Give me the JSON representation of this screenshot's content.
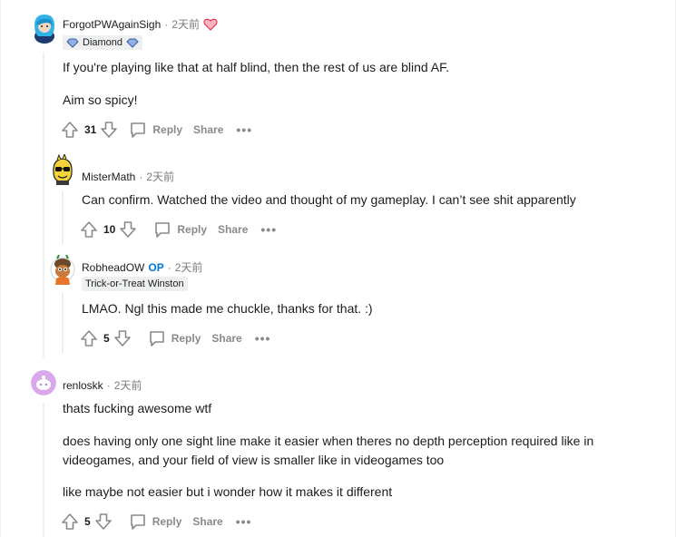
{
  "comments": [
    {
      "username": "ForgotPWAgainSigh",
      "time": "2天前",
      "flair": "Diamond",
      "paragraphs": [
        "If you're playing like that at half blind, then the rest of us are blind AF.",
        "Aim so spicy!"
      ],
      "votes": "31",
      "reply_label": "Reply",
      "share_label": "Share",
      "more_label": "•••"
    },
    {
      "username": "MisterMath",
      "time": "2天前",
      "paragraphs": [
        "Can confirm. Watched the video and thought of my gameplay. I can’t see shit apparently"
      ],
      "votes": "10",
      "reply_label": "Reply",
      "share_label": "Share",
      "more_label": "•••"
    },
    {
      "username": "RobheadOW",
      "op_badge": "OP",
      "time": "2天前",
      "flair": "Trick-or-Treat Winston",
      "paragraphs": [
        "LMAO. Ngl this made me chuckle, thanks for that. :)"
      ],
      "votes": "5",
      "reply_label": "Reply",
      "share_label": "Share",
      "more_label": "•••"
    },
    {
      "username": "renloskk",
      "time": "2天前",
      "paragraphs": [
        "thats fucking awesome wtf",
        "does having only one sight line make it easier when theres no depth perception required like in videogames, and your field of view is smaller like in videogames too",
        "like maybe not easier but i wonder how it makes it different"
      ],
      "votes": "5",
      "reply_label": "Reply",
      "share_label": "Share",
      "more_label": "•••"
    }
  ],
  "colors": {
    "meta_gray": "#7c7c7c",
    "action_gray": "#878a8c",
    "op_blue": "#0079d3",
    "thread_line": "#edeff1",
    "flair_bg": "#edeff1"
  },
  "icons": [
    "upvote-icon",
    "downvote-icon",
    "comment-bubble-icon",
    "diamond-icon",
    "heart-award-icon"
  ]
}
